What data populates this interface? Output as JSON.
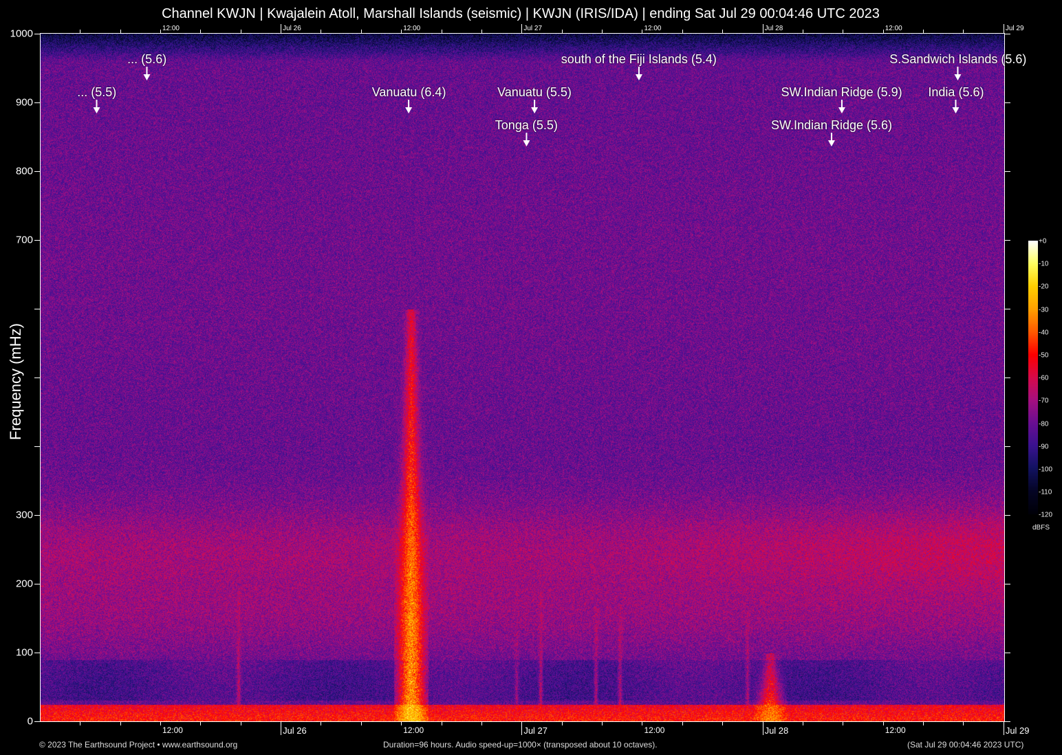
{
  "title": "Channel KWJN | Kwajalein Atoll, Marshall Islands (seismic) | KWJN (IRIS/IDA) | ending Sat Jul 29 00:04:46 UTC 2023",
  "footer": {
    "copyright": "© 2023 The Earthsound Project • www.earthsound.org",
    "info": "Duration=96 hours. Audio speed-up=1000× (transposed about 10 octaves).",
    "end_time": "(Sat Jul 29 00:04:46 2023 UTC)"
  },
  "chart_data": {
    "type": "heatmap",
    "subtype": "spectrogram",
    "title": "Channel KWJN | Kwajalein Atoll, Marshall Islands (seismic) | KWJN (IRIS/IDA) | ending Sat Jul 29 00:04:46 UTC 2023",
    "ylabel": "Frequency (mHz)",
    "ylim": [
      0,
      1000
    ],
    "xlim_hours": [
      0,
      96
    ],
    "y_ticks": [
      0,
      100,
      200,
      300,
      400,
      500,
      600,
      700,
      800,
      900,
      1000
    ],
    "y_tick_labels": [
      {
        "value": 0,
        "label": "0"
      },
      {
        "value": 100,
        "label": "100"
      },
      {
        "value": 200,
        "label": "200"
      },
      {
        "value": 300,
        "label": "300"
      },
      {
        "value": 700,
        "label": "700"
      },
      {
        "value": 800,
        "label": "800"
      },
      {
        "value": 900,
        "label": "900"
      },
      {
        "value": 1000,
        "label": "1000"
      }
    ],
    "x_minor_tick_hours_start": 3.92,
    "x_minor_tick_step_hours": 4,
    "x_tick_labels": [
      {
        "hour": 11.92,
        "label": "12:00",
        "major": false
      },
      {
        "hour": 23.92,
        "label": "Jul 26",
        "major": true
      },
      {
        "hour": 35.92,
        "label": "12:00",
        "major": false
      },
      {
        "hour": 47.92,
        "label": "Jul 27",
        "major": true
      },
      {
        "hour": 59.92,
        "label": "12:00",
        "major": false
      },
      {
        "hour": 71.92,
        "label": "Jul 28",
        "major": true
      },
      {
        "hour": 83.92,
        "label": "12:00",
        "major": false
      },
      {
        "hour": 95.92,
        "label": "Jul 29",
        "major": true
      }
    ],
    "colorbar": {
      "unit": "dBFS",
      "range": [
        -120,
        0
      ],
      "tick_labels": [
        "+0",
        "-10",
        "-20",
        "-30",
        "-40",
        "-50",
        "-60",
        "-70",
        "-80",
        "-90",
        "-100",
        "-110",
        "-120"
      ],
      "colormap": [
        {
          "db": -120,
          "color": "#000008"
        },
        {
          "db": -110,
          "color": "#050525"
        },
        {
          "db": -100,
          "color": "#121260"
        },
        {
          "db": -90,
          "color": "#3a1290"
        },
        {
          "db": -80,
          "color": "#6a0e92"
        },
        {
          "db": -70,
          "color": "#a51080"
        },
        {
          "db": -60,
          "color": "#d80a4a"
        },
        {
          "db": -50,
          "color": "#ff0000"
        },
        {
          "db": -40,
          "color": "#ff5a00"
        },
        {
          "db": -30,
          "color": "#ffa000"
        },
        {
          "db": -20,
          "color": "#ffd000"
        },
        {
          "db": -10,
          "color": "#ffff60"
        },
        {
          "db": 0,
          "color": "#ffffff"
        }
      ]
    },
    "events": [
      {
        "label": "... (5.5)",
        "hour": 5.6,
        "row": 2
      },
      {
        "label": "... (5.6)",
        "hour": 10.6,
        "row": 1
      },
      {
        "label": "Vanuatu (6.4)",
        "hour": 36.7,
        "row": 2
      },
      {
        "label": "Tonga (5.5)",
        "hour": 48.4,
        "row": 3
      },
      {
        "label": "Vanuatu (5.5)",
        "hour": 49.2,
        "row": 2
      },
      {
        "label": "south of the Fiji Islands (5.4)",
        "hour": 59.6,
        "row": 1
      },
      {
        "label": "SW.Indian Ridge (5.6)",
        "hour": 78.8,
        "row": 3
      },
      {
        "label": "SW.Indian Ridge (5.9)",
        "hour": 79.8,
        "row": 2
      },
      {
        "label": "India (5.6)",
        "hour": 91.2,
        "row": 2
      },
      {
        "label": "S.Sandwich Islands (5.6)",
        "hour": 91.4,
        "row": 1
      }
    ],
    "signals": [
      {
        "hour": 19.7,
        "fmax": 190,
        "peak_db": -60
      },
      {
        "hour": 36.9,
        "fmax": 600,
        "peak_db": -15
      },
      {
        "hour": 47.4,
        "fmax": 150,
        "peak_db": -65
      },
      {
        "hour": 49.8,
        "fmax": 190,
        "peak_db": -58
      },
      {
        "hour": 55.3,
        "fmax": 170,
        "peak_db": -60
      },
      {
        "hour": 57.7,
        "fmax": 170,
        "peak_db": -60
      },
      {
        "hour": 70.4,
        "fmax": 160,
        "peak_db": -62
      },
      {
        "hour": 72.7,
        "fmax": 100,
        "peak_db": -30
      }
    ]
  }
}
